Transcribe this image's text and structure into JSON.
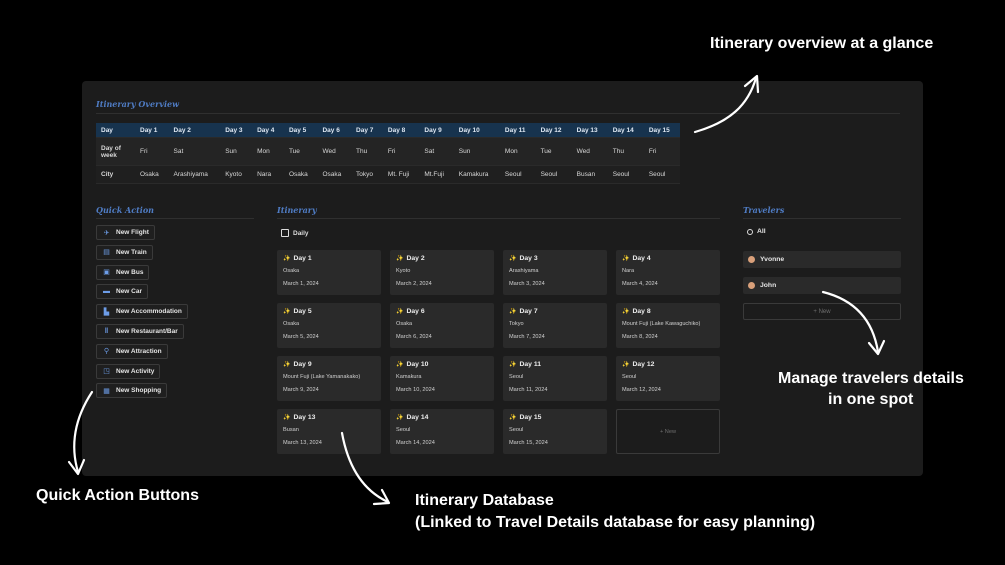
{
  "overview": {
    "title": "Itinerary Overview",
    "header": [
      "Day",
      "Day 1",
      "Day 2",
      "Day 3",
      "Day 4",
      "Day 5",
      "Day 6",
      "Day 7",
      "Day 8",
      "Day 9",
      "Day 10",
      "Day 11",
      "Day 12",
      "Day 13",
      "Day 14",
      "Day 15"
    ],
    "dow": [
      "Day of week",
      "Fri",
      "Sat",
      "Sun",
      "Mon",
      "Tue",
      "Wed",
      "Thu",
      "Fri",
      "Sat",
      "Sun",
      "Mon",
      "Tue",
      "Wed",
      "Thu",
      "Fri"
    ],
    "city": [
      "City",
      "Osaka",
      "Arashiyama",
      "Kyoto",
      "Nara",
      "Osaka",
      "Osaka",
      "Tokyo",
      "Mt. Fuji",
      "Mt.Fuji",
      "Kamakura",
      "Seoul",
      "Seoul",
      "Busan",
      "Seoul",
      "Seoul"
    ]
  },
  "quick_action": {
    "title": "Quick Action",
    "buttons": [
      {
        "label": "New Flight",
        "icon": "plane-icon"
      },
      {
        "label": "New Train",
        "icon": "train-icon"
      },
      {
        "label": "New Bus",
        "icon": "bus-icon"
      },
      {
        "label": "New Car",
        "icon": "car-icon"
      },
      {
        "label": "New Accommodation",
        "icon": "bed-icon"
      },
      {
        "label": "New Restaurant/Bar",
        "icon": "utensils-icon"
      },
      {
        "label": "New Attraction",
        "icon": "pin-icon"
      },
      {
        "label": "New Activity",
        "icon": "activity-icon"
      },
      {
        "label": "New Shopping",
        "icon": "shopping-icon"
      }
    ]
  },
  "itinerary": {
    "title": "Itinerary",
    "view_label": "Daily",
    "new_label": "+ New",
    "cards": [
      {
        "title": "Day 1",
        "city": "Osaka",
        "date": "March 1, 2024"
      },
      {
        "title": "Day 2",
        "city": "Kyoto",
        "date": "March 2, 2024"
      },
      {
        "title": "Day 3",
        "city": "Arashiyama",
        "date": "March 3, 2024"
      },
      {
        "title": "Day 4",
        "city": "Nara",
        "date": "March 4, 2024"
      },
      {
        "title": "Day 5",
        "city": "Osaka",
        "date": "March 5, 2024"
      },
      {
        "title": "Day 6",
        "city": "Osaka",
        "date": "March 6, 2024"
      },
      {
        "title": "Day 7",
        "city": "Tokyo",
        "date": "March 7, 2024"
      },
      {
        "title": "Day 8",
        "city": "Mount Fuji (Lake Kawaguchiko)",
        "date": "March 8, 2024"
      },
      {
        "title": "Day 9",
        "city": "Mount Fuji (Lake Yamanakako)",
        "date": "March 9, 2024"
      },
      {
        "title": "Day 10",
        "city": "Kamakura",
        "date": "March 10, 2024"
      },
      {
        "title": "Day 11",
        "city": "Seoul",
        "date": "March 11, 2024"
      },
      {
        "title": "Day 12",
        "city": "Seoul",
        "date": "March 12, 2024"
      },
      {
        "title": "Day 13",
        "city": "Busan",
        "date": "March 13, 2024"
      },
      {
        "title": "Day 14",
        "city": "Seoul",
        "date": "March 14, 2024"
      },
      {
        "title": "Day 15",
        "city": "Seoul",
        "date": "March 15, 2024"
      }
    ]
  },
  "travelers": {
    "title": "Travelers",
    "all_label": "All",
    "people": [
      "Yvonne",
      "John"
    ],
    "new_label": "+ New"
  },
  "annotations": {
    "overview": "Itinerary overview at a glance",
    "travelers_line1": "Manage travelers details",
    "travelers_line2": "in one spot",
    "quick_action": "Quick Action Buttons",
    "database_line1": "Itinerary Database",
    "database_line2": "(Linked to Travel Details database for easy planning)"
  },
  "colors": {
    "accent": "#4f7cc4",
    "header_bg": "#17334e",
    "panel": "#1c1c1c",
    "card": "#2a2a2a"
  }
}
